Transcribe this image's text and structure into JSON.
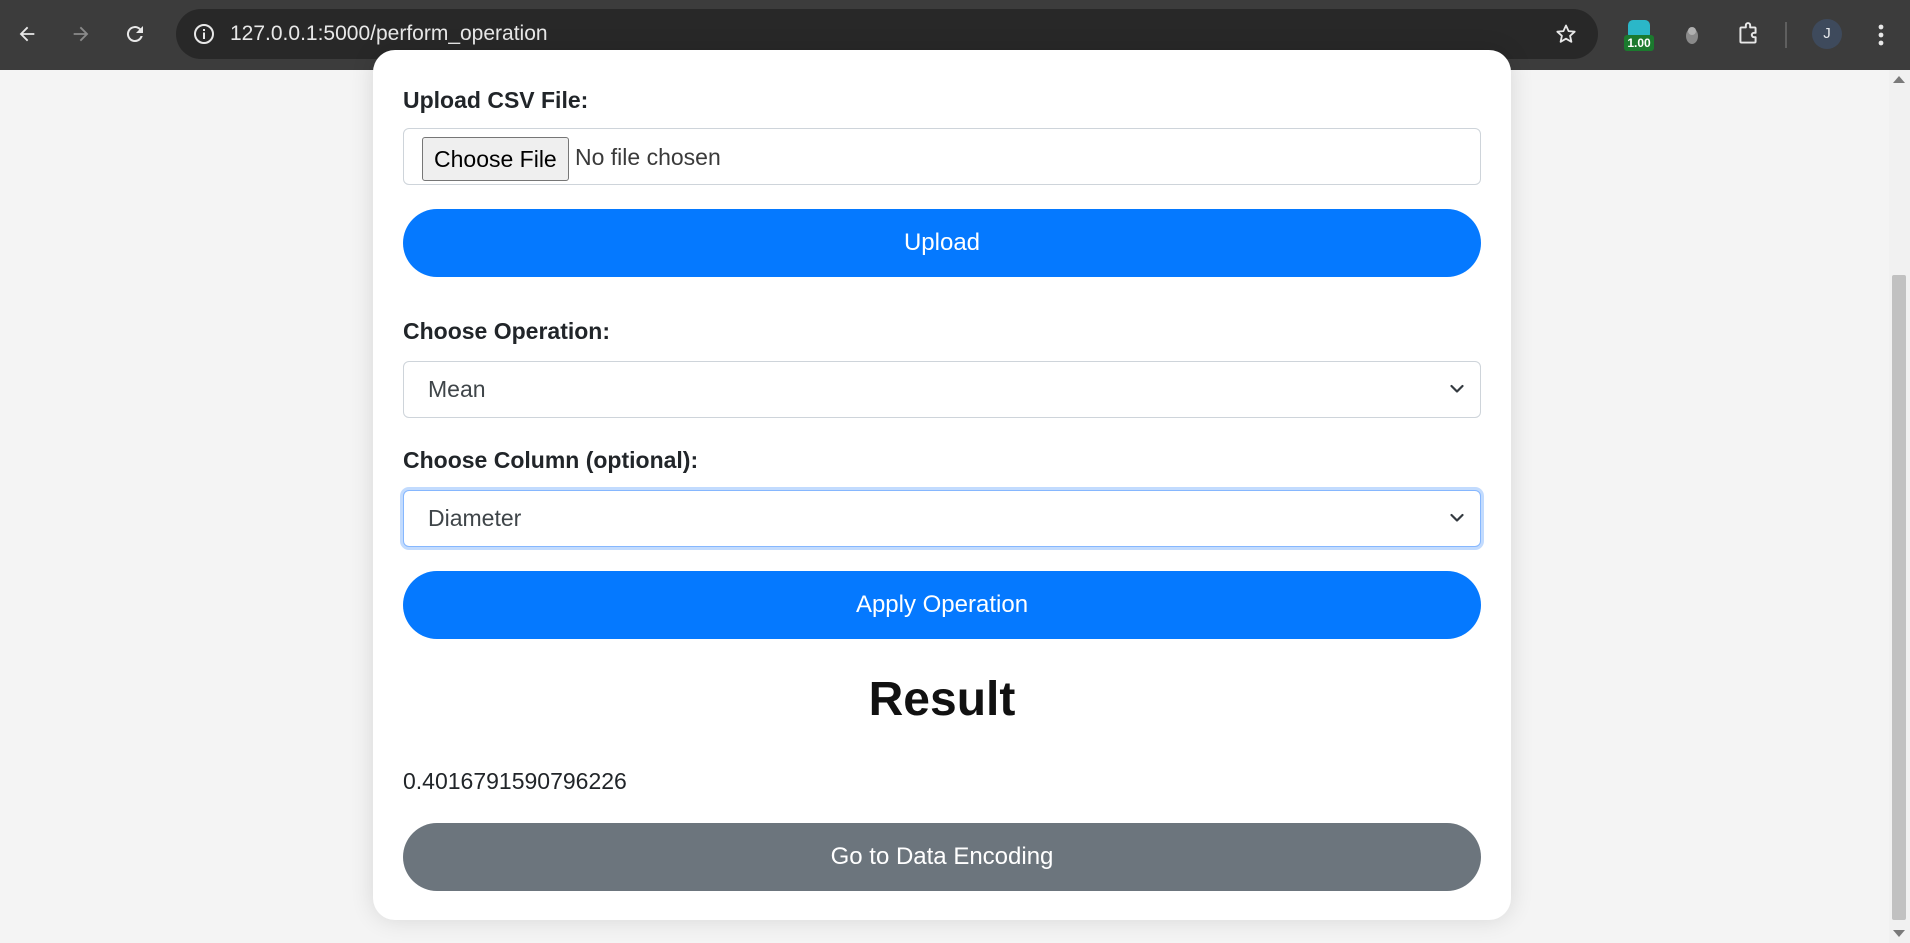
{
  "browser": {
    "url": "127.0.0.1:5000/perform_operation",
    "extension_badge": "1.00",
    "profile_initial": "J"
  },
  "form": {
    "upload_label": "Upload CSV File:",
    "choose_file_button": "Choose File",
    "no_file_text": "No file chosen",
    "upload_button": "Upload",
    "operation_label": "Choose Operation:",
    "operation_value": "Mean",
    "column_label": "Choose Column (optional):",
    "column_value": "Diameter",
    "apply_button": "Apply Operation"
  },
  "result": {
    "heading": "Result",
    "value": "0.4016791590796226"
  },
  "footer": {
    "encoding_button": "Go to Data Encoding"
  },
  "colors": {
    "primary": "#0579ff",
    "secondary": "#6c757d",
    "focus": "#86b7fe"
  },
  "icons": [
    "back-arrow-icon",
    "forward-arrow-icon",
    "reload-icon",
    "site-info-icon",
    "star-icon",
    "extension-badge-icon",
    "extension-icon",
    "puzzle-icon",
    "avatar",
    "kebab-menu-icon",
    "chevron-down-icon"
  ]
}
